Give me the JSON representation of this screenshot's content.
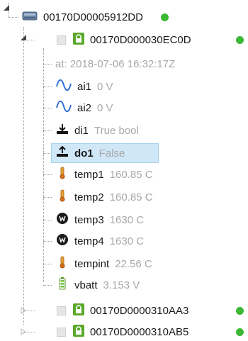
{
  "root": {
    "label": "00170D00005912DD",
    "status_color": "#3cb834"
  },
  "device_expanded": {
    "label": "00170D000030EC0D",
    "status_color": "#3cb834"
  },
  "timestamp": "at: 2018-07-06 16:32:17Z",
  "channels": [
    {
      "name": "ai1",
      "value": "0 V",
      "icon": "sine-wave-icon"
    },
    {
      "name": "ai2",
      "value": "0 V",
      "icon": "sine-wave-icon"
    },
    {
      "name": "di1",
      "value": "True bool",
      "icon": "digital-input-icon"
    },
    {
      "name": "do1",
      "value": "False",
      "icon": "digital-output-icon",
      "selected": true
    },
    {
      "name": "temp1",
      "value": "160.85 C",
      "icon": "thermometer-icon"
    },
    {
      "name": "temp2",
      "value": "160.85 C",
      "icon": "thermometer-icon"
    },
    {
      "name": "temp3",
      "value": "1630 C",
      "icon": "sensor-icon"
    },
    {
      "name": "temp4",
      "value": "1630 C",
      "icon": "sensor-icon"
    },
    {
      "name": "tempint",
      "value": "22.56 C",
      "icon": "thermometer-icon"
    },
    {
      "name": "vbatt",
      "value": "3.153 V",
      "icon": "battery-icon"
    }
  ],
  "devices_collapsed": [
    {
      "label": "00170D0000310AA3",
      "status_color": "#3cb834"
    },
    {
      "label": "00170D0000310AB5",
      "status_color": "#3cb834"
    }
  ],
  "colors": {
    "selection": "#cfe7f7",
    "status_online": "#3cb834",
    "lock_green": "#5ba82c"
  }
}
